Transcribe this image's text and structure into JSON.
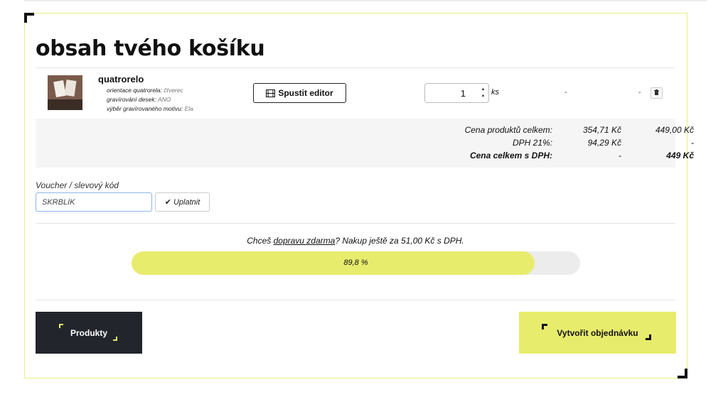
{
  "page": {
    "title": "obsah tvého košíku"
  },
  "cart": {
    "item": {
      "name": "quatrorelo",
      "options": [
        {
          "label": "orientace quatrorela:",
          "value": "čtverec"
        },
        {
          "label": "gravírování desek:",
          "value": "ANO"
        },
        {
          "label": "výběr gravírovaného motivu:",
          "value": "Ela"
        }
      ],
      "editor_label": "Spustit editor",
      "quantity": "1",
      "unit": "ks",
      "price_excl": "-",
      "price_incl": "-",
      "thumbnail_icon": "product-photo"
    },
    "summary": {
      "products_total_label": "Cena produktů celkem:",
      "products_total_excl": "354,71 Kč",
      "products_total_incl": "449,00 Kč",
      "vat_label": "DPH 21%:",
      "vat_excl": "94,29 Kč",
      "vat_incl": "-",
      "grand_total_label": "Cena celkem s DPH:",
      "grand_total_excl": "-",
      "grand_total_incl": "449 Kč"
    }
  },
  "voucher": {
    "label": "Voucher / slevový kód",
    "value": "SKRBLÍK",
    "apply_label": "Uplatnit"
  },
  "shipping": {
    "text_before": "Chceš ",
    "link": "dopravu zdarma",
    "text_after": "? Nakup ještě za 51,00 Kč s DPH.",
    "progress_percent": 89.8,
    "progress_label": "89,8 %"
  },
  "actions": {
    "products_label": "Produkty",
    "order_label": "Vytvořit objednávku"
  },
  "colors": {
    "accent": "#e8ec6c",
    "dark": "#22262c"
  }
}
